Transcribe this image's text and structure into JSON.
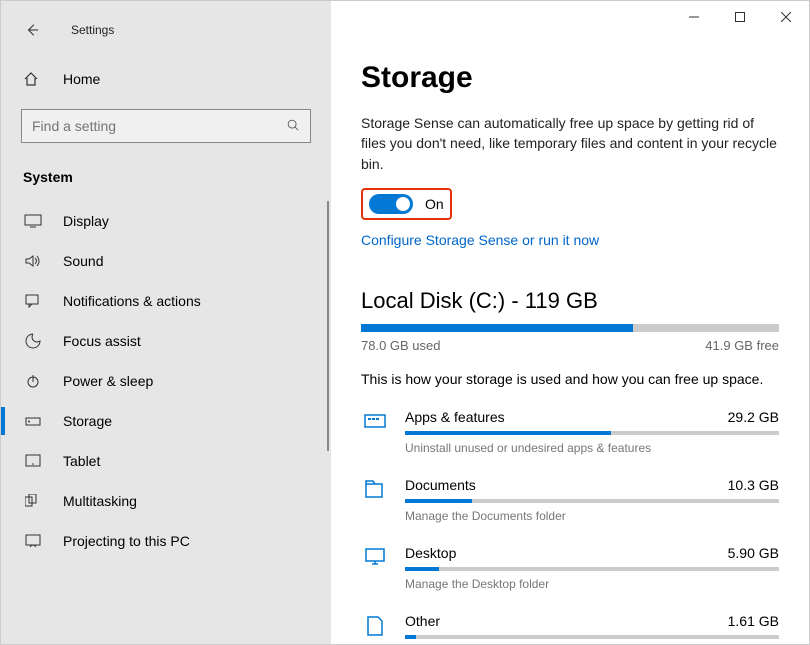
{
  "window": {
    "title": "Settings"
  },
  "sidebar": {
    "home": "Home",
    "search_placeholder": "Find a setting",
    "section": "System",
    "items": [
      {
        "label": "Display"
      },
      {
        "label": "Sound"
      },
      {
        "label": "Notifications & actions"
      },
      {
        "label": "Focus assist"
      },
      {
        "label": "Power & sleep"
      },
      {
        "label": "Storage"
      },
      {
        "label": "Tablet"
      },
      {
        "label": "Multitasking"
      },
      {
        "label": "Projecting to this PC"
      }
    ]
  },
  "main": {
    "heading": "Storage",
    "storage_sense_desc": "Storage Sense can automatically free up space by getting rid of files you don't need, like temporary files and content in your recycle bin.",
    "toggle_state": "On",
    "configure_link": "Configure Storage Sense or run it now",
    "disk": {
      "title": "Local Disk (C:) - 119 GB",
      "used_label": "78.0 GB used",
      "free_label": "41.9 GB free",
      "used_pct": 65
    },
    "storage_explain": "This is how your storage is used and how you can free up space.",
    "categories": [
      {
        "name": "Apps & features",
        "size": "29.2 GB",
        "hint": "Uninstall unused or undesired apps & features",
        "pct": 55
      },
      {
        "name": "Documents",
        "size": "10.3 GB",
        "hint": "Manage the Documents folder",
        "pct": 18
      },
      {
        "name": "Desktop",
        "size": "5.90 GB",
        "hint": "Manage the Desktop folder",
        "pct": 9
      },
      {
        "name": "Other",
        "size": "1.61 GB",
        "hint": "",
        "pct": 3
      }
    ]
  }
}
